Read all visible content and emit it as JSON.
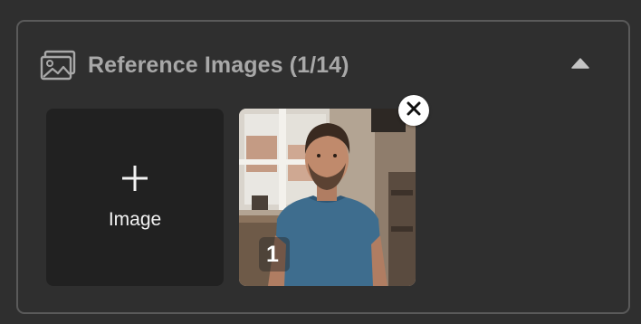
{
  "section": {
    "title": "Reference Images (1/14)",
    "header_icon": "images-icon",
    "collapse_icon": "caret-up-icon"
  },
  "add_tile": {
    "label": "Image",
    "icon": "plus-icon"
  },
  "images": [
    {
      "index_label": "1",
      "remove_icon": "close-icon"
    }
  ],
  "colors": {
    "background": "#2f2f2f",
    "panel_border": "#5a5a5a",
    "title": "#a8a8a8",
    "tile_background": "#212121",
    "tile_text": "#f2f2f2"
  }
}
